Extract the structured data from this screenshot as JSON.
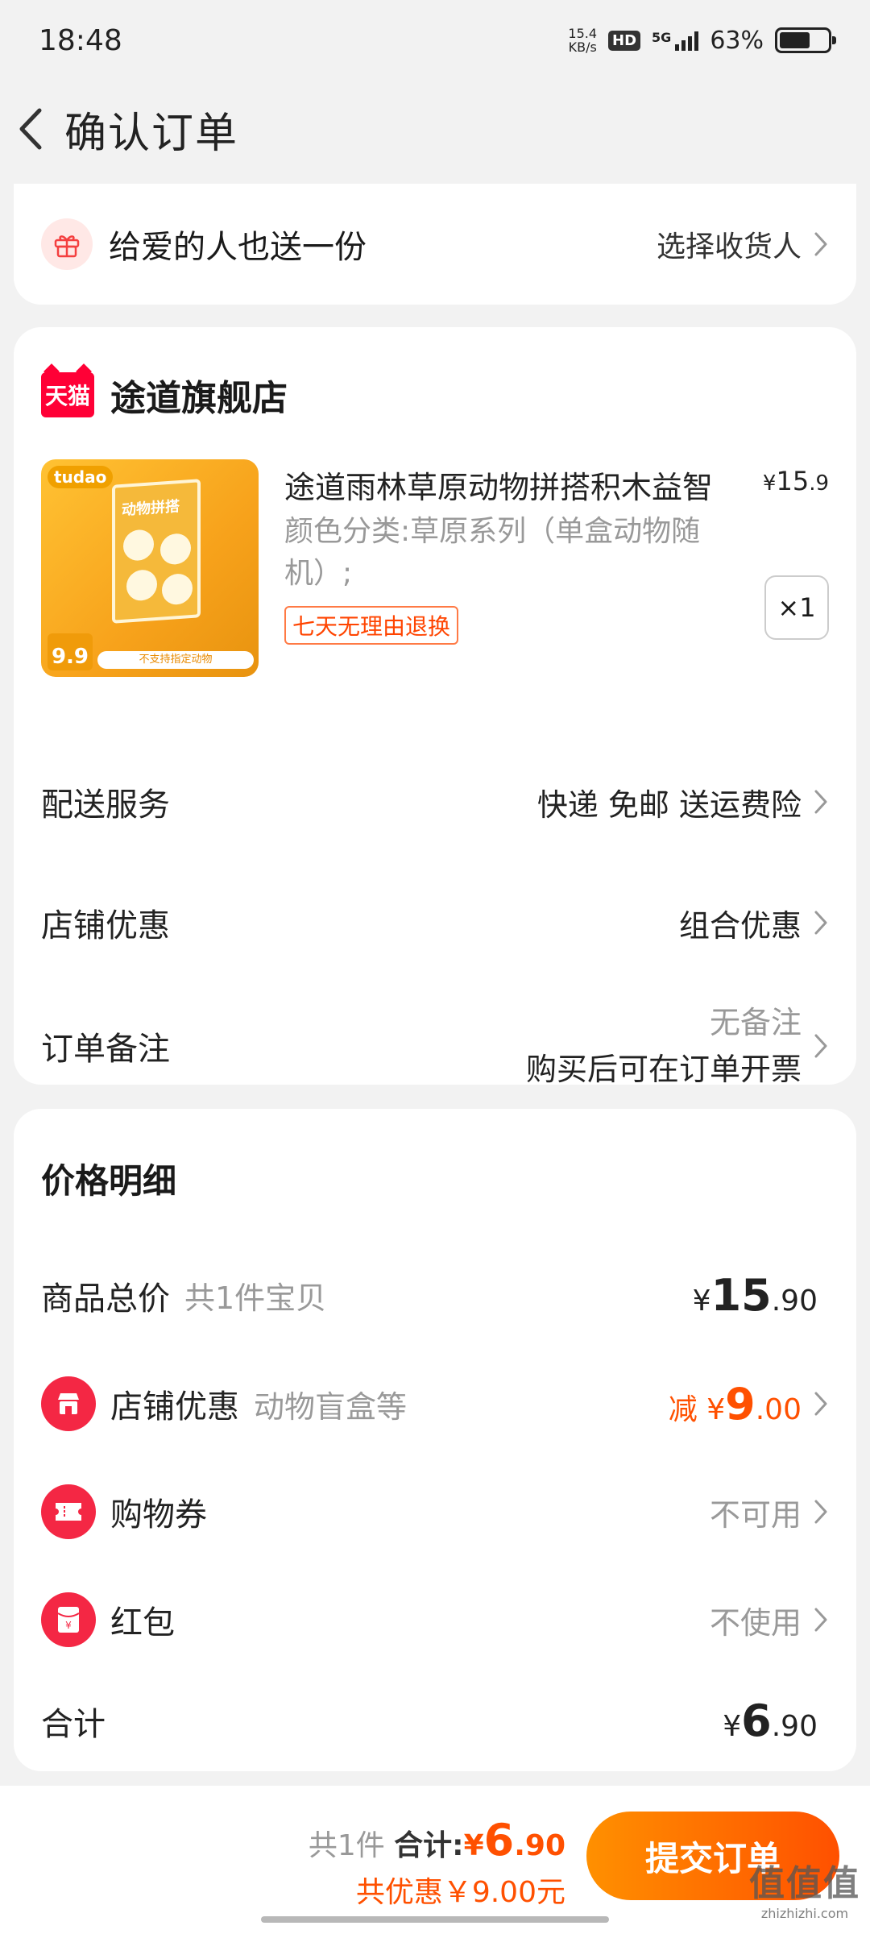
{
  "status_bar": {
    "time": "18:48",
    "net_speed_value": "15.4",
    "net_speed_unit": "KB/s",
    "hd_badge": "HD",
    "network": "5G",
    "battery_text": "63%",
    "battery_level": 0.63
  },
  "nav": {
    "title": "确认订单"
  },
  "gift": {
    "text": "给爱的人也送一份",
    "action": "选择收货人"
  },
  "shop": {
    "badge": "天猫",
    "name": "途道旗舰店",
    "product": {
      "title": "途道雨林草原动物拼搭积木益智",
      "price_symbol": "¥",
      "price_int": "15",
      "price_dec": ".9",
      "spec": "颜色分类:草原系列（单盒动物随机）;",
      "return_tag": "七天无理由退换",
      "qty": "×1",
      "thumb_brand": "tudao",
      "thumb_box_title": "动物拼搭",
      "thumb_price": "9.9",
      "thumb_footer": "不支持指定动物"
    },
    "delivery": {
      "label": "配送服务",
      "value": "快递 免邮 送运费险"
    },
    "discount": {
      "label": "店铺优惠",
      "value": "组合优惠"
    },
    "remark": {
      "label": "订单备注",
      "value_line1": "无备注",
      "value_line2": "购买后可在订单开票"
    }
  },
  "price_detail": {
    "title": "价格明细",
    "goods_total": {
      "label": "商品总价",
      "note": "共1件宝贝",
      "symbol": "¥",
      "int": "15",
      "dec": ".90"
    },
    "shop_discount": {
      "label": "店铺优惠",
      "note": "动物盲盒等",
      "prefix": "减 ¥",
      "int": "9",
      "dec": ".00"
    },
    "coupon": {
      "label": "购物券",
      "value": "不可用"
    },
    "red_packet": {
      "label": "红包",
      "value": "不使用",
      "icon_char": "¥"
    },
    "total": {
      "label": "合计",
      "symbol": "¥",
      "int": "6",
      "dec": ".90"
    }
  },
  "bottom": {
    "count": "共1件",
    "sum_label": "合计:",
    "sum_symbol": "¥",
    "sum_int": "6",
    "sum_dec": ".90",
    "saved": "共优惠￥9.00元",
    "submit": "提交订单",
    "watermark_main": "值值值",
    "watermark_sub": "zhizhizhi.com"
  },
  "colors": {
    "accent": "#ff5000",
    "tmall_red": "#ff0036",
    "button_start": "#ff9000"
  }
}
